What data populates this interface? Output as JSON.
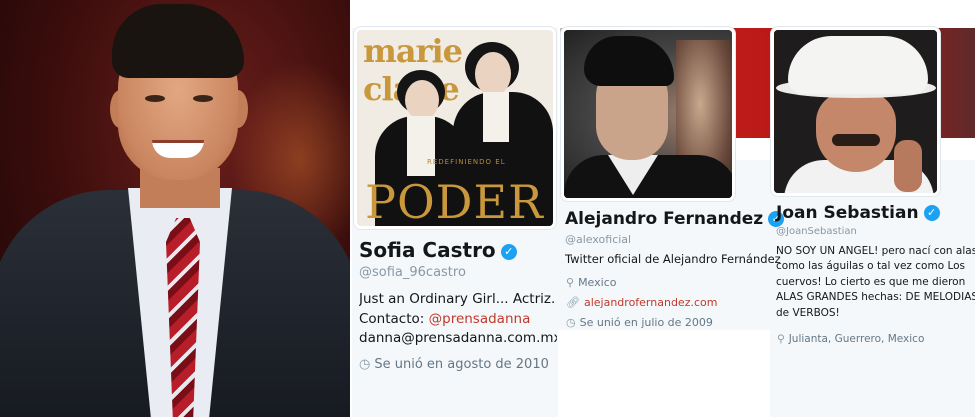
{
  "colors": {
    "verified": "#1da1f2",
    "link": "#c0392b",
    "name": "#14171a",
    "muted": "#8899a6",
    "card_bg": "#f5f8fa"
  },
  "profiles": [
    {
      "name": "Sofia Castro",
      "handle": "@sofia_96castro",
      "bio": [
        "Just an Ordinary Girl... Actriz. :)",
        "Contacto: ",
        "danna@prensadanna.com.mx"
      ],
      "bio_link": "@prensadanna",
      "joined": "Se unió en agosto de 2010",
      "avatar_text": {
        "magazine": "marie claire",
        "cover_line": "REDEFINIENDO EL",
        "headline": "PODER"
      }
    },
    {
      "name": "Alejandro Fernandez",
      "handle": "@alexoficial",
      "bio": "Twitter oficial de Alejandro Fernández",
      "location": "Mexico",
      "website": "alejandrofernandez.com",
      "joined": "Se unió en julio de 2009"
    },
    {
      "name": "Joan Sebastian",
      "handle": "@JoanSebastian",
      "bio": [
        "NO SOY UN ANGEL! pero nací con alas",
        "como las águilas o tal vez como Los",
        "cuervos! Lo cierto es que me dieron",
        "ALAS GRANDES hechas: DE MELODIAS",
        "de VERBOS!"
      ],
      "location": "Julianta, Guerrero, Mexico"
    }
  ],
  "icons": {
    "verified": "verified-badge-icon",
    "calendar": "clock-icon",
    "location": "location-pin-icon",
    "link": "link-icon"
  }
}
